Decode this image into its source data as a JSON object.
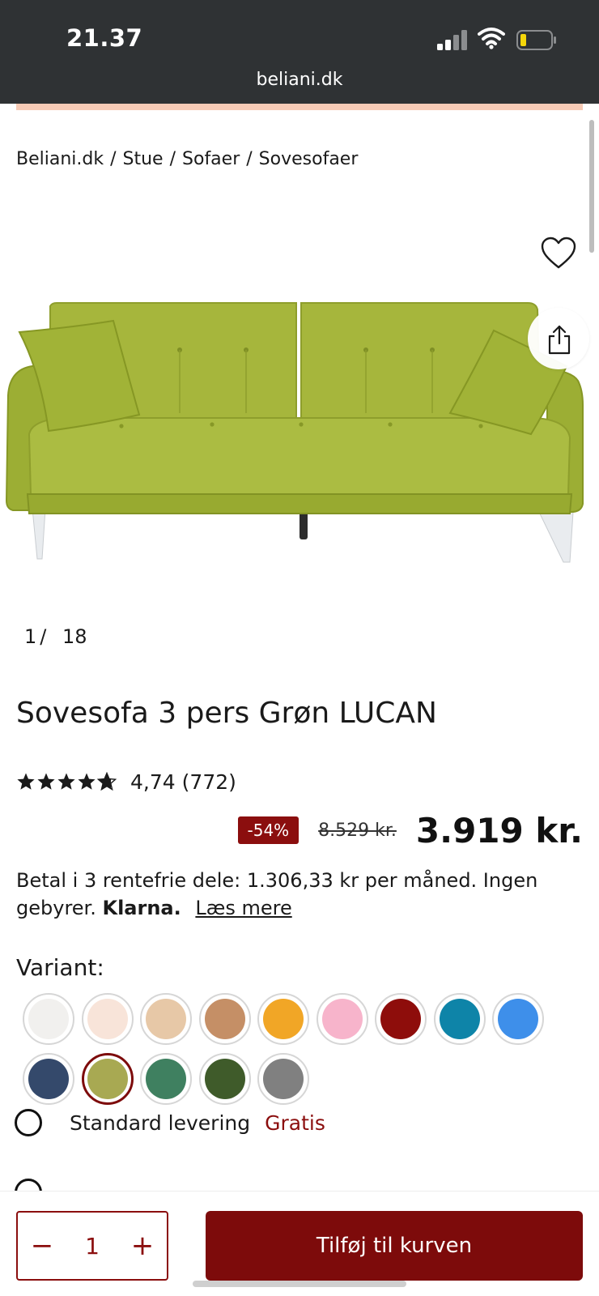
{
  "status_bar": {
    "time": "21.37",
    "url": "beliani.dk"
  },
  "breadcrumb": [
    "Beliani.dk",
    "Stue",
    "Sofaer",
    "Sovesofaer"
  ],
  "gallery": {
    "current": "1",
    "separator": "/",
    "total": "18"
  },
  "product": {
    "title": "Sovesofa 3 pers Grøn LUCAN",
    "rating_value": "4,74",
    "review_count": "(772)",
    "rating_stars": 4.74,
    "discount": "-54%",
    "old_price": "8.529 kr.",
    "price": "3.919 kr."
  },
  "klarna": {
    "text": "Betal i 3 rentefrie dele: 1.306,33 kr per måned. Ingen gebyrer.",
    "brand": "Klarna.",
    "link": "Læs mere"
  },
  "variant": {
    "label": "Variant:",
    "colors": [
      "#f1f0ee",
      "#f8e4d9",
      "#e7c8a7",
      "#c58f66",
      "#f1a626",
      "#f7b4cb",
      "#8e0d0b",
      "#0e84a8",
      "#3e8fea",
      "#34496b",
      "#a8a952",
      "#3f8060",
      "#3f5b2a",
      "#808080"
    ],
    "selected_index": 10
  },
  "delivery": {
    "label": "Standard levering",
    "price": "Gratis"
  },
  "cart": {
    "minus": "−",
    "quantity": "1",
    "plus": "+",
    "add_label": "Tilføj til kurven"
  },
  "colors": {
    "brand": "#7d0b0b",
    "sofa": "#a4b53a",
    "promo_strip": "#f7cbb6"
  }
}
